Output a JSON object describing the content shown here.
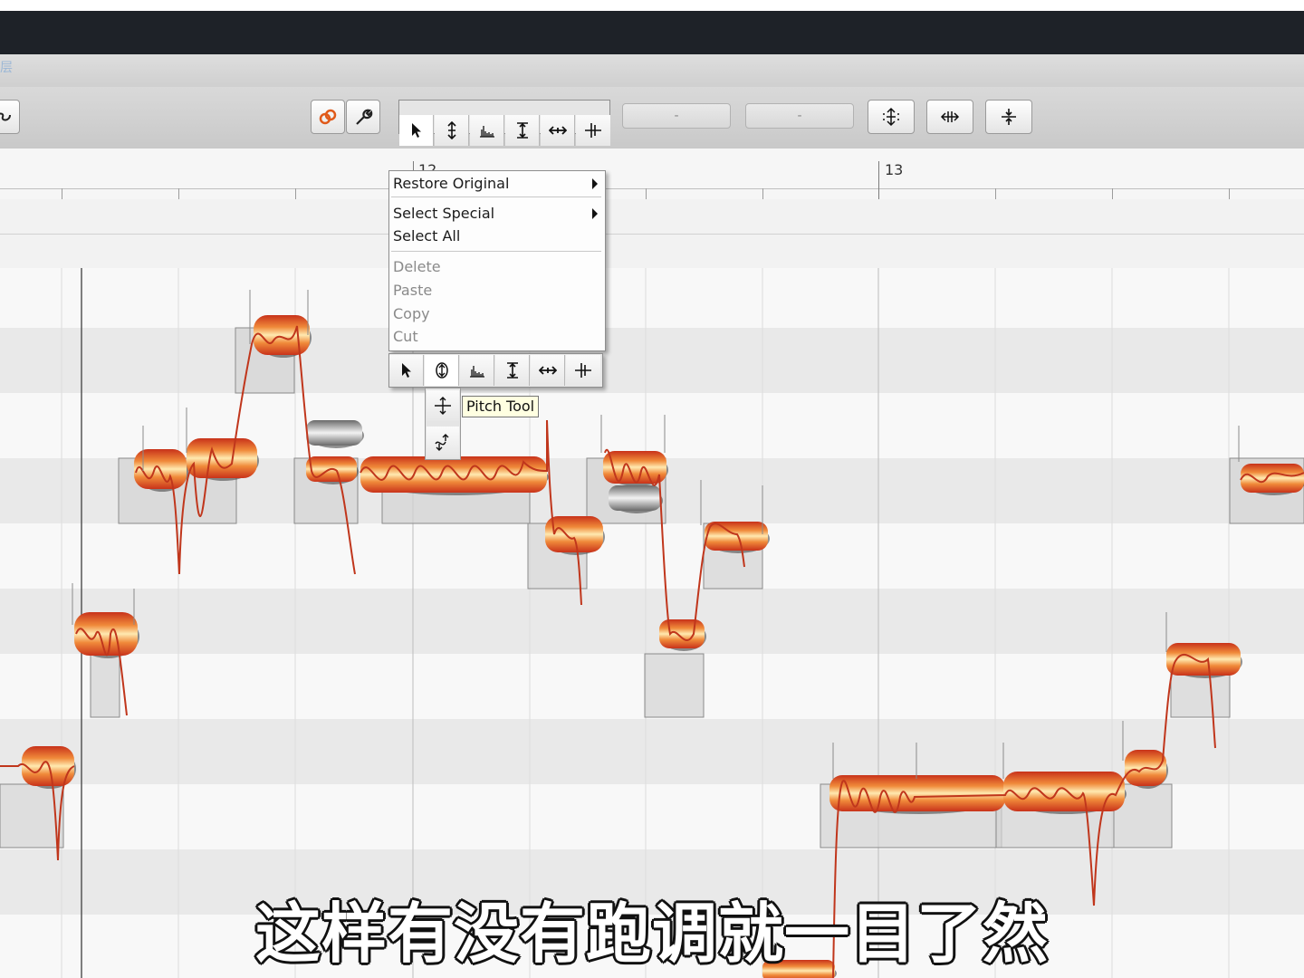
{
  "colors": {
    "title_bar": "#1e2228",
    "blob_core": "#ffe9b0",
    "blob_mid": "#f08a3a",
    "blob_edge": "#c8321a",
    "pitch_line": "#c0361c",
    "note_box": "#d3d3d3",
    "tooltip_bg": "#ffffe1"
  },
  "toolbar": {
    "left_icons": [
      "link-icon"
    ],
    "mode_icons": [
      "macro-icon",
      "wrench-icon"
    ],
    "tools": [
      "pointer-icon",
      "pitch-tool-icon",
      "formant-icon",
      "amplitude-icon",
      "time-tool-icon",
      "separation-icon"
    ],
    "field1": "-",
    "field2": "-",
    "right_icons": [
      "quantize-pitch-icon",
      "quantize-time-icon",
      "center-pitch-icon"
    ]
  },
  "ruler": {
    "bars": [
      {
        "label": "12"
      },
      {
        "label": "13"
      }
    ]
  },
  "context_menu": {
    "items": [
      {
        "label": "Restore Original",
        "submenu": true,
        "enabled": true
      },
      {
        "label": "Select Special",
        "submenu": true,
        "enabled": true
      },
      {
        "label": "Select All",
        "submenu": false,
        "enabled": true
      },
      {
        "label": "Delete",
        "submenu": false,
        "enabled": false
      },
      {
        "label": "Paste",
        "submenu": false,
        "enabled": false
      },
      {
        "label": "Copy",
        "submenu": false,
        "enabled": false
      },
      {
        "label": "Cut",
        "submenu": false,
        "enabled": false
      }
    ]
  },
  "popup_tools": {
    "tools": [
      "pointer-icon",
      "pitch-tool-icon",
      "formant-icon",
      "amplitude-icon",
      "time-tool-icon",
      "separation-icon"
    ],
    "sub_tools": [
      "pitch-move-icon",
      "pitch-drift-icon"
    ],
    "tooltip": "Pitch Tool"
  },
  "subtitle": "这样有没有跑调就一目了然"
}
